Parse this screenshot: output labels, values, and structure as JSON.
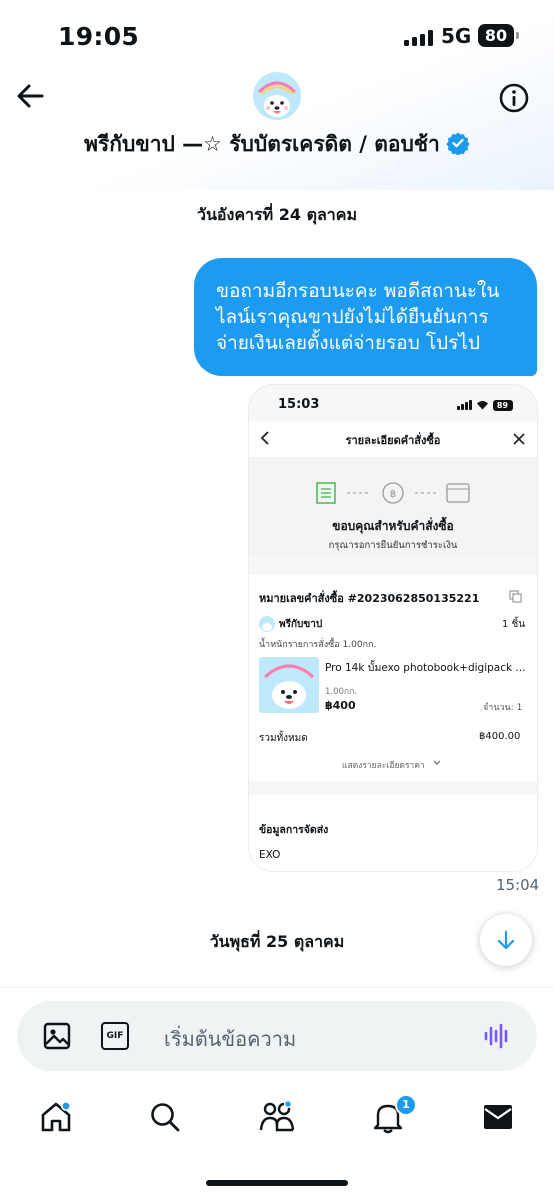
{
  "status_bar": {
    "time": "19:05",
    "network": "5G",
    "battery": "80"
  },
  "header": {
    "title": "พรีกับขาป —☆ รับบัตรเครดิต / ตอบช้า",
    "avatar_label": "พรีกับขาป"
  },
  "messages": {
    "date_1": "วันอังคารที่ 24 ตุลาคม",
    "bubble_lines": [
      "ขอถามอีกรอบนะคะ พอดีสถานะใน",
      "ไลน์เราคุณขาปยังไม่ได้ยืนยันการ",
      "จ่ายเงินเลยตั้งแต่จ่ายรอบ โปรไป"
    ],
    "timestamp": "15:04",
    "date_2": "วันพุธที่ 25 ตุลาคม"
  },
  "screenshot": {
    "time": "15:03",
    "battery": "89",
    "header_title": "รายละเอียดคำสั่งซื้อ",
    "thanks": "ขอบคุณสำหรับคำสั่งซื้อ",
    "confirm_note": "กรุณารอการยืนยันการชำระเงิน",
    "order_number": "หมายเลขคำสั่งซื้อ #2023062850135221",
    "shop_name": "พรีกับขาป",
    "item_count": "1 ชิ้น",
    "weight_label": "น้ำหนักรายการสั่งซื้อ 1.00กก.",
    "product_name": "Pro 14k บั้มexo photobook+digipack ...",
    "product_weight": "1.00กก.",
    "product_price": "฿400",
    "quantity": "จำนวน: 1",
    "total_label": "รวมทั้งหมด",
    "total_value": "฿400.00",
    "price_details": "แสดงรายละเอียดราคา",
    "shipping_label": "ข้อมูลการจัดส่ง",
    "shipping_value": "EXO",
    "logo_text": "พรีกับขาป"
  },
  "composer": {
    "placeholder": "เริ่มต้นข้อความ",
    "gif_label": "GIF"
  },
  "nav": {
    "notification_count": "1"
  },
  "colors": {
    "accent": "#1d9bf0",
    "text": "#0f1419",
    "muted": "#536471",
    "compose_bg": "#eff3f4",
    "voice": "#7856ff"
  }
}
